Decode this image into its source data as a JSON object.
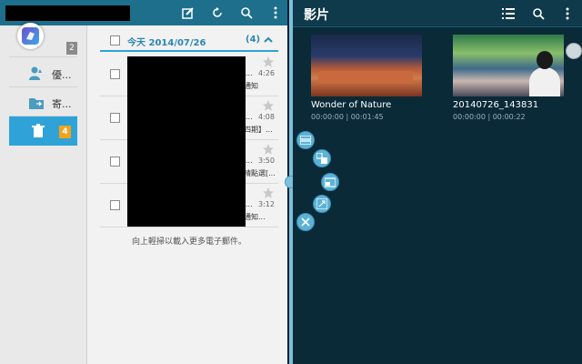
{
  "email": {
    "nav": {
      "item1_badge": "2",
      "item2_label": "優...",
      "item3_label": "寄...",
      "trash_badge": "4"
    },
    "list": {
      "date_label": "今天  2014/07/26",
      "count": "(4)",
      "rows": [
        {
          "time": "4:26",
          "snippet": "通知",
          "pre": "..."
        },
        {
          "time": "4:08",
          "snippet": "四期】...",
          "pre": "..."
        },
        {
          "time": "3:50",
          "snippet": "精點選[...",
          "pre": "..."
        },
        {
          "time": "3:12",
          "snippet": "通知...",
          "pre": "..."
        }
      ],
      "load_more": "向上輕掃以載入更多電子郵件。"
    }
  },
  "videos": {
    "title": "影片",
    "items": [
      {
        "name": "Wonder of Nature",
        "duration": "00:00:00 | 00:01:45"
      },
      {
        "name": "20140726_143831",
        "duration": "00:00:00 | 00:00:22"
      }
    ]
  },
  "colors": {
    "email_header": "#1d6f8c",
    "accent_blue": "#2fa3d8",
    "badge_orange": "#f2a31b",
    "video_bg": "#0b2a38"
  }
}
